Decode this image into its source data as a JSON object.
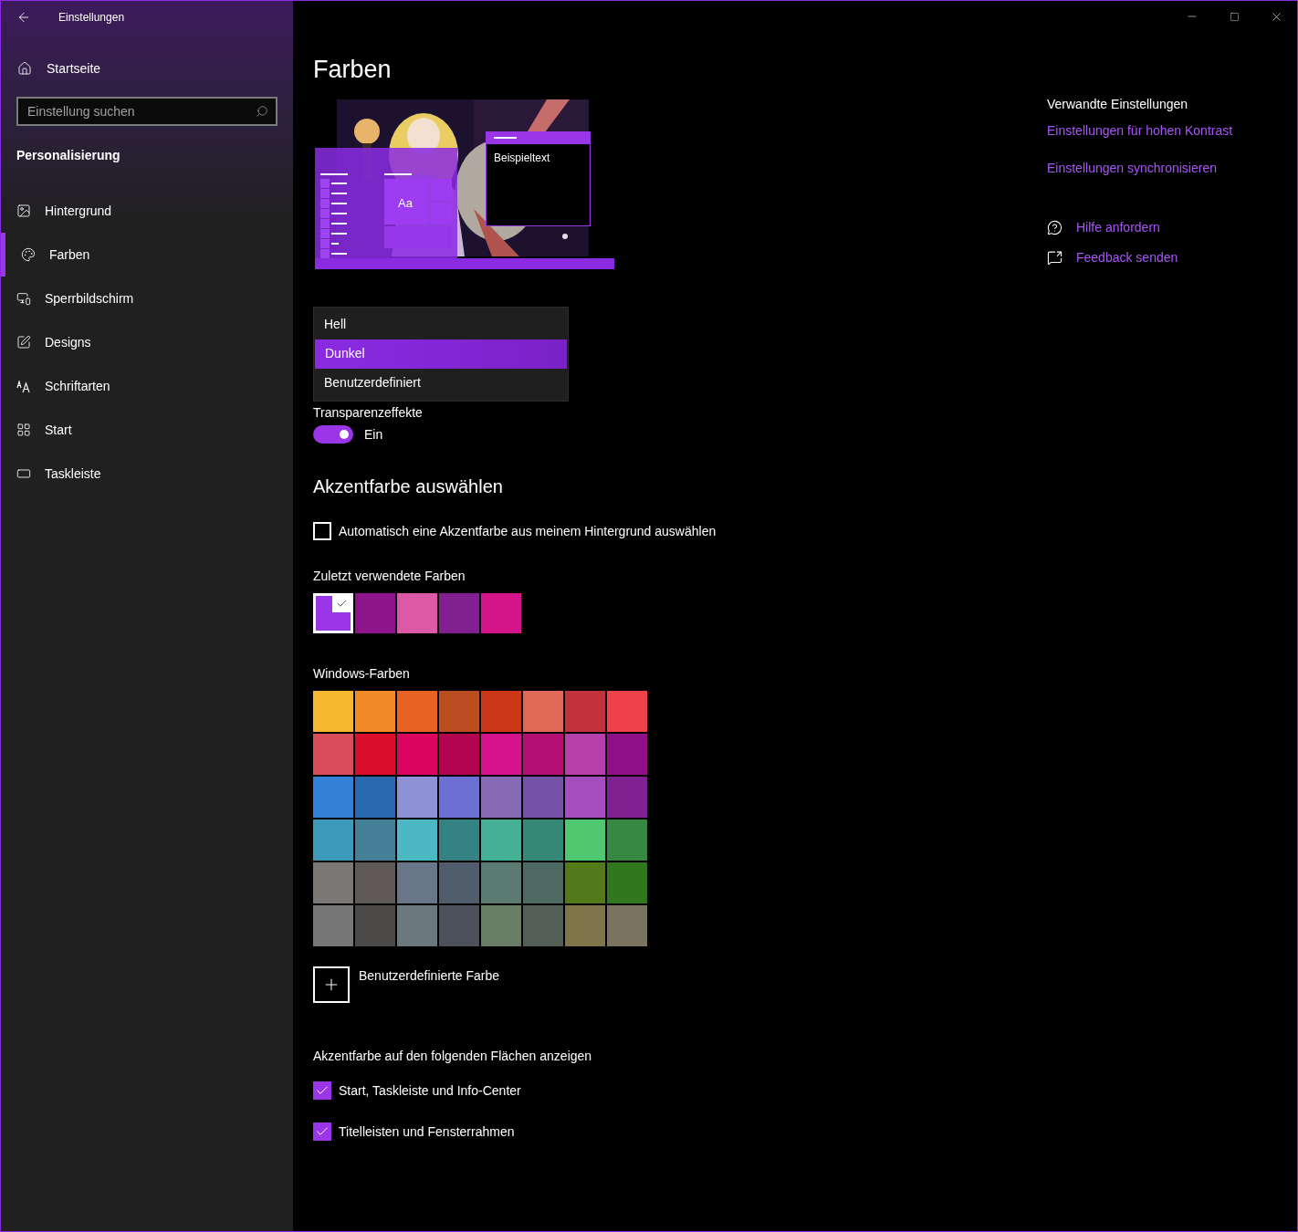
{
  "window": {
    "title": "Einstellungen"
  },
  "sidebar": {
    "home": "Startseite",
    "search": {
      "placeholder": "Einstellung suchen"
    },
    "section": "Personalisierung",
    "items": [
      {
        "label": "Hintergrund",
        "selected": false
      },
      {
        "label": "Farben",
        "selected": true
      },
      {
        "label": "Sperrbildschirm",
        "selected": false
      },
      {
        "label": "Designs",
        "selected": false
      },
      {
        "label": "Schriftarten",
        "selected": false
      },
      {
        "label": "Start",
        "selected": false
      },
      {
        "label": "Taskleiste",
        "selected": false
      }
    ]
  },
  "page": {
    "title": "Farben",
    "preview": {
      "tile_text": "Aa",
      "sample_text": "Beispieltext"
    },
    "mode_dropdown": {
      "options": [
        {
          "label": "Hell",
          "selected": false
        },
        {
          "label": "Dunkel",
          "selected": true
        },
        {
          "label": "Benutzerdefiniert",
          "selected": false
        }
      ]
    },
    "transparency": {
      "label": "Transparenzeffekte",
      "on": true,
      "state_text": "Ein"
    },
    "accent_heading": "Akzentfarbe auswählen",
    "auto_accent": {
      "label": "Automatisch eine Akzentfarbe aus meinem Hintergrund auswählen",
      "checked": false
    },
    "recent": {
      "label": "Zuletzt verwendete Farben",
      "colors": [
        {
          "color": "#9a35e8",
          "selected": true
        },
        {
          "color": "#8d148a",
          "selected": false
        },
        {
          "color": "#dc59a6",
          "selected": false
        },
        {
          "color": "#81208f",
          "selected": false
        },
        {
          "color": "#d41489",
          "selected": false
        }
      ]
    },
    "windows_colors": {
      "label": "Windows-Farben",
      "colors": [
        {
          "color": "#f6b731"
        },
        {
          "color": "#f28b27"
        },
        {
          "color": "#e86224"
        },
        {
          "color": "#bb4e20"
        },
        {
          "color": "#cb3717"
        },
        {
          "color": "#e26957"
        },
        {
          "color": "#c2323b"
        },
        {
          "color": "#ed4249"
        },
        {
          "color": "#da4b5c"
        },
        {
          "color": "#d80e2c"
        },
        {
          "color": "#db055f"
        },
        {
          "color": "#b3044f"
        },
        {
          "color": "#d4138c"
        },
        {
          "color": "#b30f74"
        },
        {
          "color": "#b640ab"
        },
        {
          "color": "#901187"
        },
        {
          "color": "#3380d6"
        },
        {
          "color": "#2a69af"
        },
        {
          "color": "#8f91d6"
        },
        {
          "color": "#6d6fd3"
        },
        {
          "color": "#876ab5"
        },
        {
          "color": "#7452a5"
        },
        {
          "color": "#a54cbe"
        },
        {
          "color": "#802091"
        },
        {
          "color": "#3d9aba"
        },
        {
          "color": "#437f97"
        },
        {
          "color": "#4bb8c3"
        },
        {
          "color": "#348284"
        },
        {
          "color": "#46b096"
        },
        {
          "color": "#348875"
        },
        {
          "color": "#4fc86f"
        },
        {
          "color": "#378843"
        },
        {
          "color": "#7b7774"
        },
        {
          "color": "#5e5956"
        },
        {
          "color": "#687687"
        },
        {
          "color": "#525d6b"
        },
        {
          "color": "#5b7a71"
        },
        {
          "color": "#4e6a63"
        },
        {
          "color": "#527a1b"
        },
        {
          "color": "#31771e"
        },
        {
          "color": "#777777"
        },
        {
          "color": "#4b4a49"
        },
        {
          "color": "#6a787e"
        },
        {
          "color": "#4b525a"
        },
        {
          "color": "#687c66"
        },
        {
          "color": "#535f56"
        },
        {
          "color": "#80744a"
        },
        {
          "color": "#7b7360"
        }
      ]
    },
    "custom_color": "Benutzerdefinierte Farbe",
    "surfaces": {
      "label": "Akzentfarbe auf den folgenden Flächen anzeigen",
      "options": [
        {
          "label": "Start, Taskleiste und Info-Center",
          "checked": true
        },
        {
          "label": "Titelleisten und Fensterrahmen",
          "checked": true
        }
      ]
    }
  },
  "related": {
    "heading": "Verwandte Einstellungen",
    "links": [
      "Einstellungen für hohen Kontrast",
      "Einstellungen synchronisieren"
    ],
    "help": [
      "Hilfe anfordern",
      "Feedback senden"
    ]
  }
}
